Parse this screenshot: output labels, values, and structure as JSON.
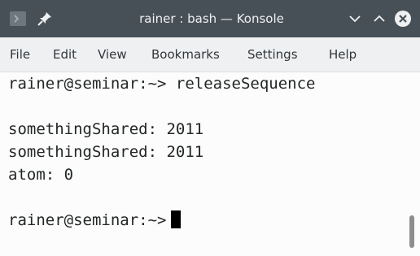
{
  "window": {
    "title": "rainer : bash — Konsole"
  },
  "titlebar": {
    "app_icon": "terminal-icon",
    "pin_icon": "pin-icon",
    "minimize_icon": "chevron-down-icon",
    "maximize_icon": "chevron-up-icon",
    "close_icon": "close-icon"
  },
  "menubar": {
    "items": [
      {
        "label": "File"
      },
      {
        "label": "Edit"
      },
      {
        "label": "View"
      },
      {
        "label": "Bookmarks"
      },
      {
        "label": "Settings"
      },
      {
        "label": "Help"
      }
    ]
  },
  "terminal": {
    "lines": [
      "rainer@seminar:~> releaseSequence",
      "",
      "somethingShared: 2011",
      "somethingShared: 2011",
      "atom: 0",
      "",
      "rainer@seminar:~>"
    ]
  },
  "colors": {
    "titlebar_bg": "#475057",
    "close_button": "#da4453",
    "menubar_bg": "#eff0f1",
    "terminal_bg": "#fcfcfc",
    "terminal_text": "#232627"
  }
}
